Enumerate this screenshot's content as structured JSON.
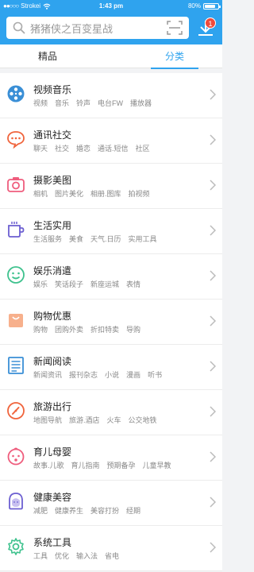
{
  "status": {
    "carrier": "Strokei",
    "time": "1:43 pm",
    "battery": "80%"
  },
  "search": {
    "placeholder": "猪猪侠之百变星战"
  },
  "download": {
    "badge": "1"
  },
  "tabs": [
    {
      "label": "精品"
    },
    {
      "label": "分类"
    }
  ],
  "colors": {
    "accent": "#2fa3ee",
    "badge": "#f04a3b"
  },
  "categories": [
    {
      "title": "视频音乐",
      "icon": "film-reel-icon",
      "tags": [
        "视频",
        "音乐",
        "铃声",
        "电台FW",
        "播放器"
      ]
    },
    {
      "title": "通讯社交",
      "icon": "chat-bubble-icon",
      "tags": [
        "聊天",
        "社交",
        "婚恋",
        "通话.短信",
        "社区"
      ]
    },
    {
      "title": "摄影美图",
      "icon": "camera-icon",
      "tags": [
        "相机",
        "图片美化",
        "相册.图库",
        "拍视频"
      ]
    },
    {
      "title": "生活实用",
      "icon": "mug-icon",
      "tags": [
        "生活服务",
        "美食",
        "天气.日历",
        "实用工具"
      ]
    },
    {
      "title": "娱乐消遣",
      "icon": "smiley-icon",
      "tags": [
        "娱乐",
        "笑话段子",
        "新座运城",
        "表情"
      ]
    },
    {
      "title": "购物优惠",
      "icon": "shopping-bag-icon",
      "tags": [
        "购物",
        "团购外卖",
        "折扣特卖",
        "导购"
      ]
    },
    {
      "title": "新闻阅读",
      "icon": "newspaper-icon",
      "tags": [
        "新闻资讯",
        "报刊杂志",
        "小说",
        "漫画",
        "听书"
      ]
    },
    {
      "title": "旅游出行",
      "icon": "compass-gauge-icon",
      "tags": [
        "地图导航",
        "旅游.酒店",
        "火车",
        "公交地铁"
      ]
    },
    {
      "title": "育儿母婴",
      "icon": "baby-face-icon",
      "tags": [
        "故事.儿歌",
        "育儿指南",
        "预期备孕",
        "儿童早教"
      ]
    },
    {
      "title": "健康美容",
      "icon": "woman-face-icon",
      "tags": [
        "减肥",
        "健康养生",
        "美容打扮",
        "经期"
      ]
    },
    {
      "title": "系统工具",
      "icon": "gear-icon",
      "tags": [
        "工具",
        "优化",
        "输入法",
        "省电"
      ]
    }
  ]
}
